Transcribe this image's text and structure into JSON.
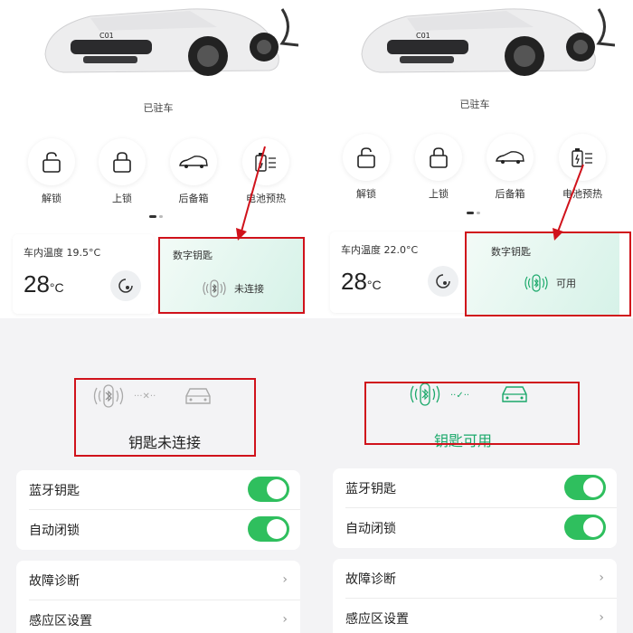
{
  "left_top": {
    "parked": "已驻车",
    "car_badge": "C01",
    "actions": [
      {
        "label": "解锁",
        "icon": "unlock-icon"
      },
      {
        "label": "上锁",
        "icon": "lock-icon"
      },
      {
        "label": "后备箱",
        "icon": "trunk-icon"
      },
      {
        "label": "电池预热",
        "icon": "battery-heat-icon"
      }
    ],
    "temp_card": {
      "title": "车内温度 19.5°C",
      "value": "28",
      "unit": "°C"
    },
    "key_card": {
      "title": "数字钥匙",
      "status": "未连接"
    }
  },
  "right_top": {
    "parked": "已驻车",
    "car_badge": "C01",
    "actions": [
      {
        "label": "解锁",
        "icon": "unlock-icon"
      },
      {
        "label": "上锁",
        "icon": "lock-icon"
      },
      {
        "label": "后备箱",
        "icon": "trunk-icon"
      },
      {
        "label": "电池预热",
        "icon": "battery-heat-icon"
      }
    ],
    "temp_card": {
      "title": "车内温度 22.0°C",
      "value": "28",
      "unit": "°C"
    },
    "key_card": {
      "title": "数字钥匙",
      "status": "可用"
    }
  },
  "left_bottom": {
    "status": "钥匙未连接",
    "rows": [
      {
        "label": "蓝牙钥匙",
        "type": "toggle",
        "on": true
      },
      {
        "label": "自动闭锁",
        "type": "toggle",
        "on": true
      },
      {
        "label": "故障诊断",
        "type": "link"
      },
      {
        "label": "感应区设置",
        "type": "link"
      }
    ]
  },
  "right_bottom": {
    "status": "钥匙可用",
    "rows": [
      {
        "label": "蓝牙钥匙",
        "type": "toggle",
        "on": true
      },
      {
        "label": "自动闭锁",
        "type": "toggle",
        "on": true
      },
      {
        "label": "故障诊断",
        "type": "link"
      },
      {
        "label": "感应区设置",
        "type": "link"
      }
    ]
  },
  "colors": {
    "accent_green": "#2fbf5e",
    "highlight_red": "#d0121b",
    "key_green": "#1aa86a"
  }
}
